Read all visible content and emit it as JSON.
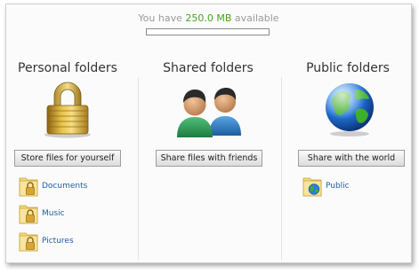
{
  "quota": {
    "prefix": "You have",
    "amount": "250.0 MB",
    "suffix": "available",
    "used_fraction": 0.0
  },
  "columns": {
    "personal": {
      "title": "Personal folders",
      "icon": "padlock-icon",
      "button": "Store files for yourself",
      "folders": [
        {
          "label": "Documents",
          "icon": "locked-folder-icon"
        },
        {
          "label": "Music",
          "icon": "locked-folder-icon"
        },
        {
          "label": "Pictures",
          "icon": "locked-folder-icon"
        }
      ]
    },
    "shared": {
      "title": "Shared folders",
      "icon": "people-icon",
      "button": "Share files with friends",
      "folders": []
    },
    "public": {
      "title": "Public folders",
      "icon": "globe-icon",
      "button": "Share with the world",
      "folders": [
        {
          "label": "Public",
          "icon": "globe-folder-icon"
        }
      ]
    }
  },
  "colors": {
    "amount": "#46a31a",
    "link": "#1d5fa5",
    "folder": "#f3d97a"
  }
}
